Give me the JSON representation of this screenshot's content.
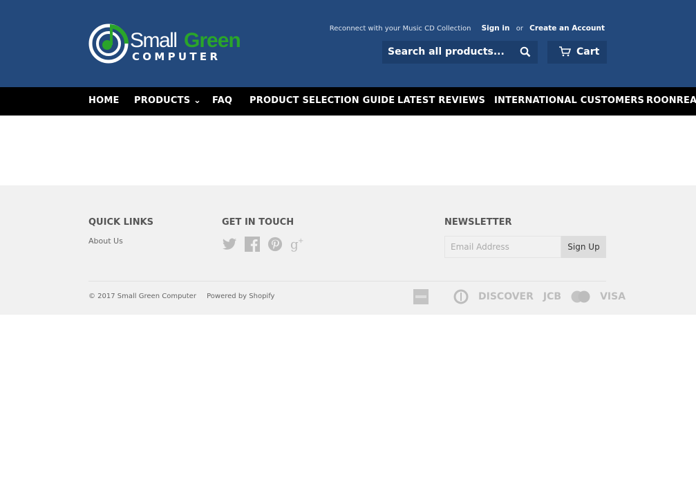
{
  "header": {
    "logo_text": [
      "Small",
      "Green",
      "COMPUTER"
    ],
    "tagline": "Reconnect with your Music CD Collection",
    "sign_in": "Sign in",
    "or": "or",
    "create_account": "Create an Account",
    "search_placeholder": "Search all products...",
    "cart_label": "Cart",
    "colors": {
      "header_bg": "#23497c",
      "logo_green": "#2aa52a"
    }
  },
  "nav": {
    "items": [
      {
        "label": "HOME"
      },
      {
        "label": "PRODUCTS ⌄"
      },
      {
        "label": "FAQ"
      },
      {
        "label": "PRODUCT SELECTION GUIDE"
      },
      {
        "label": "LATEST REVIEWS"
      },
      {
        "label": "INTERNATIONAL CUSTOMERS"
      },
      {
        "label": "ROONREADY"
      }
    ]
  },
  "footer": {
    "quick_links_title": "QUICK LINKS",
    "quick_links": [
      "About Us"
    ],
    "get_in_touch_title": "GET IN TOUCH",
    "social_icons": [
      "twitter-icon",
      "facebook-icon",
      "pinterest-icon",
      "google-plus-icon"
    ],
    "newsletter_title": "NEWSLETTER",
    "email_placeholder": "Email Address",
    "signup_label": "Sign Up",
    "copyright": "© 2017 Small Green Computer",
    "powered_by": "Powered by Shopify",
    "payment_icons": [
      "american-express-icon",
      "diners-club-icon",
      "discover-icon",
      "jcb-icon",
      "mastercard-icon",
      "visa-icon"
    ],
    "payment_labels": {
      "discover": "DISCOVER",
      "jcb": "JCB",
      "visa": "VISA"
    }
  }
}
